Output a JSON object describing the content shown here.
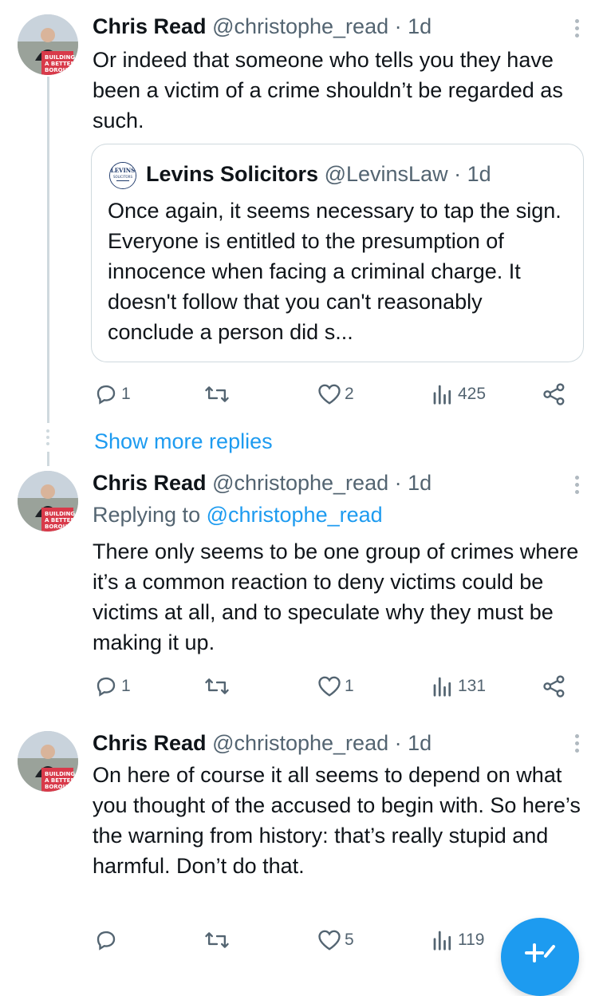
{
  "tweets": [
    {
      "name": "Chris Read",
      "handle": "@christophe_read",
      "time": "1d",
      "text": "Or indeed that someone who tells you they have been a victim of a crime shouldn’t be regarded as such.",
      "quote": {
        "name": "Levins Solicitors",
        "handle": "@LevinsLaw",
        "time": "1d",
        "text": "Once again, it seems necessary to tap the sign. Everyone is entitled to the presumption of innocence when facing a criminal charge. It doesn't follow that you can't reasonably conclude a person did s..."
      },
      "replies": "1",
      "retweets": "",
      "likes": "2",
      "views": "425"
    },
    {
      "name": "Chris Read",
      "handle": "@christophe_read",
      "time": "1d",
      "replying_label": "Replying to",
      "replying_handle": "@christophe_read",
      "text": "There only seems to be one group of crimes where it’s a common reaction to deny victims could be victims at all, and to speculate why they must be making it up.",
      "replies": "1",
      "retweets": "",
      "likes": "1",
      "views": "131"
    },
    {
      "name": "Chris Read",
      "handle": "@christophe_read",
      "time": "1d",
      "text": "On here of course it all seems to depend on what you thought of the accused to begin with. So here’s the warning from history: that’s really stupid and harmful. Don’t do that.",
      "replies": "",
      "retweets": "",
      "likes": "5",
      "views": "119"
    }
  ],
  "show_more_replies": "Show more replies",
  "separator": "·",
  "colors": {
    "accent": "#1d9bf0",
    "text": "#0f1419",
    "secondary": "#536471",
    "border": "#cfd9de"
  }
}
